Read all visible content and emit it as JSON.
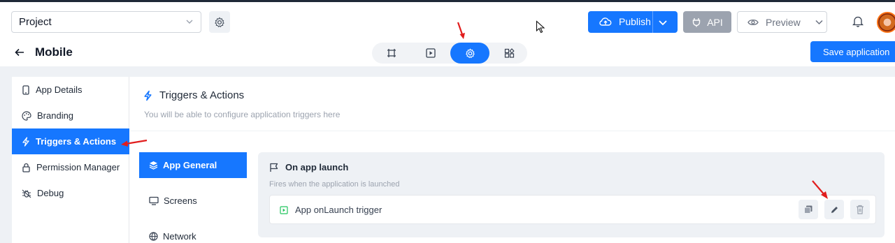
{
  "header": {
    "project_select_value": "Project",
    "publish_label": "Publish",
    "api_label": "API",
    "preview_label": "Preview"
  },
  "subheader": {
    "title": "Mobile",
    "save_label": "Save application"
  },
  "sidebar": {
    "items": [
      {
        "label": "App Details",
        "icon": "phone-icon"
      },
      {
        "label": "Branding",
        "icon": "palette-icon"
      },
      {
        "label": "Triggers & Actions",
        "icon": "lightning-icon",
        "active": true
      },
      {
        "label": "Permission Manager",
        "icon": "lock-icon"
      },
      {
        "label": "Debug",
        "icon": "bug-icon"
      }
    ]
  },
  "main": {
    "title": "Triggers & Actions",
    "subtitle": "You will be able to configure application triggers here",
    "tabs": [
      {
        "label": "App General",
        "icon": "layers-icon",
        "active": true
      },
      {
        "label": "Screens",
        "icon": "monitor-icon"
      },
      {
        "label": "Network",
        "icon": "globe-icon"
      }
    ],
    "trigger": {
      "title": "On app launch",
      "description": "Fires when the application is launched",
      "row_label": "App onLaunch trigger"
    }
  },
  "colors": {
    "accent": "#1677ff",
    "api_button": "#9ca3af",
    "panel_bg": "#eef1f5",
    "annotation_arrow": "#e11d1d"
  }
}
